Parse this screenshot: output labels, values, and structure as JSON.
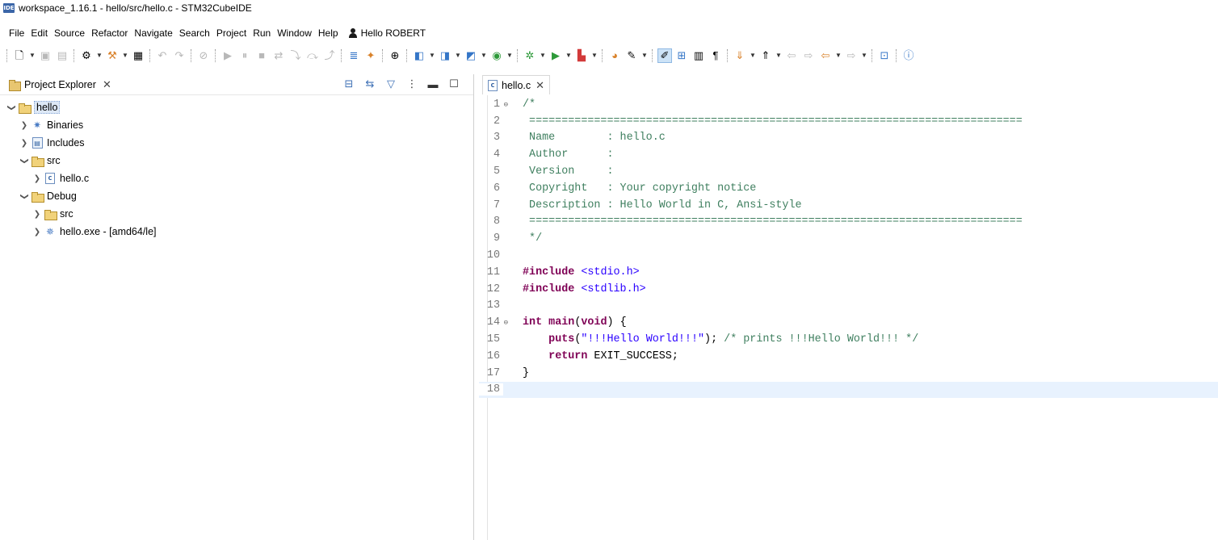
{
  "window": {
    "badge": "IDE",
    "title": "workspace_1.16.1 - hello/src/hello.c - STM32CubeIDE"
  },
  "menu": {
    "items": [
      "File",
      "Edit",
      "Source",
      "Refactor",
      "Navigate",
      "Search",
      "Project",
      "Run",
      "Window",
      "Help"
    ],
    "user_label": "Hello ROBERT"
  },
  "project_explorer": {
    "tab_label": "Project Explorer",
    "close_glyph": "✕",
    "tree": [
      {
        "label": "hello",
        "level": 0,
        "expanded": true,
        "icon": "project-folder-icon",
        "selected": true
      },
      {
        "label": "Binaries",
        "level": 1,
        "expanded": false,
        "icon": "binaries-icon"
      },
      {
        "label": "Includes",
        "level": 1,
        "expanded": false,
        "icon": "includes-icon"
      },
      {
        "label": "src",
        "level": 1,
        "expanded": true,
        "icon": "source-folder-icon"
      },
      {
        "label": "hello.c",
        "level": 2,
        "expanded": false,
        "icon": "c-file-icon"
      },
      {
        "label": "Debug",
        "level": 1,
        "expanded": true,
        "icon": "folder-icon"
      },
      {
        "label": "src",
        "level": 2,
        "expanded": false,
        "icon": "folder-icon"
      },
      {
        "label": "hello.exe - [amd64/le]",
        "level": 2,
        "expanded": false,
        "icon": "executable-icon"
      }
    ]
  },
  "editor": {
    "tab_label": "hello.c",
    "close_glyph": "✕",
    "file_icon_text": "c",
    "current_line": 18,
    "lines": [
      {
        "n": "1",
        "fold": true,
        "parts": [
          [
            "cm",
            "/*"
          ]
        ]
      },
      {
        "n": "2",
        "parts": [
          [
            "cm",
            " ============================================================================"
          ]
        ]
      },
      {
        "n": "3",
        "parts": [
          [
            "cm",
            " Name        : hello.c"
          ]
        ]
      },
      {
        "n": "4",
        "parts": [
          [
            "cm",
            " Author      :"
          ]
        ]
      },
      {
        "n": "5",
        "parts": [
          [
            "cm",
            " Version     :"
          ]
        ]
      },
      {
        "n": "6",
        "parts": [
          [
            "cm",
            " Copyright   : Your copyright notice"
          ]
        ]
      },
      {
        "n": "7",
        "parts": [
          [
            "cm",
            " Description : Hello World in C, Ansi-style"
          ]
        ]
      },
      {
        "n": "8",
        "parts": [
          [
            "cm",
            " ============================================================================"
          ]
        ]
      },
      {
        "n": "9",
        "parts": [
          [
            "cm",
            " */"
          ]
        ]
      },
      {
        "n": "10",
        "parts": []
      },
      {
        "n": "11",
        "parts": [
          [
            "kw",
            "#include"
          ],
          [
            "plain",
            " "
          ],
          [
            "str",
            "<stdio.h>"
          ]
        ]
      },
      {
        "n": "12",
        "parts": [
          [
            "kw",
            "#include"
          ],
          [
            "plain",
            " "
          ],
          [
            "str",
            "<stdlib.h>"
          ]
        ]
      },
      {
        "n": "13",
        "parts": []
      },
      {
        "n": "14",
        "fold": true,
        "parts": [
          [
            "kw",
            "int"
          ],
          [
            "plain",
            " "
          ],
          [
            "kw",
            "main"
          ],
          [
            "plain",
            "("
          ],
          [
            "kw",
            "void"
          ],
          [
            "plain",
            ") {"
          ]
        ]
      },
      {
        "n": "15",
        "parts": [
          [
            "plain",
            "    "
          ],
          [
            "kw",
            "puts"
          ],
          [
            "plain",
            "("
          ],
          [
            "str",
            "\"!!!Hello World!!!\""
          ],
          [
            "plain",
            "); "
          ],
          [
            "cm",
            "/* prints !!!Hello World!!! */"
          ]
        ]
      },
      {
        "n": "16",
        "parts": [
          [
            "plain",
            "    "
          ],
          [
            "kw",
            "return"
          ],
          [
            "plain",
            " EXIT_SUCCESS;"
          ]
        ]
      },
      {
        "n": "17",
        "parts": [
          [
            "plain",
            "}"
          ]
        ]
      },
      {
        "n": "18",
        "parts": []
      }
    ]
  }
}
